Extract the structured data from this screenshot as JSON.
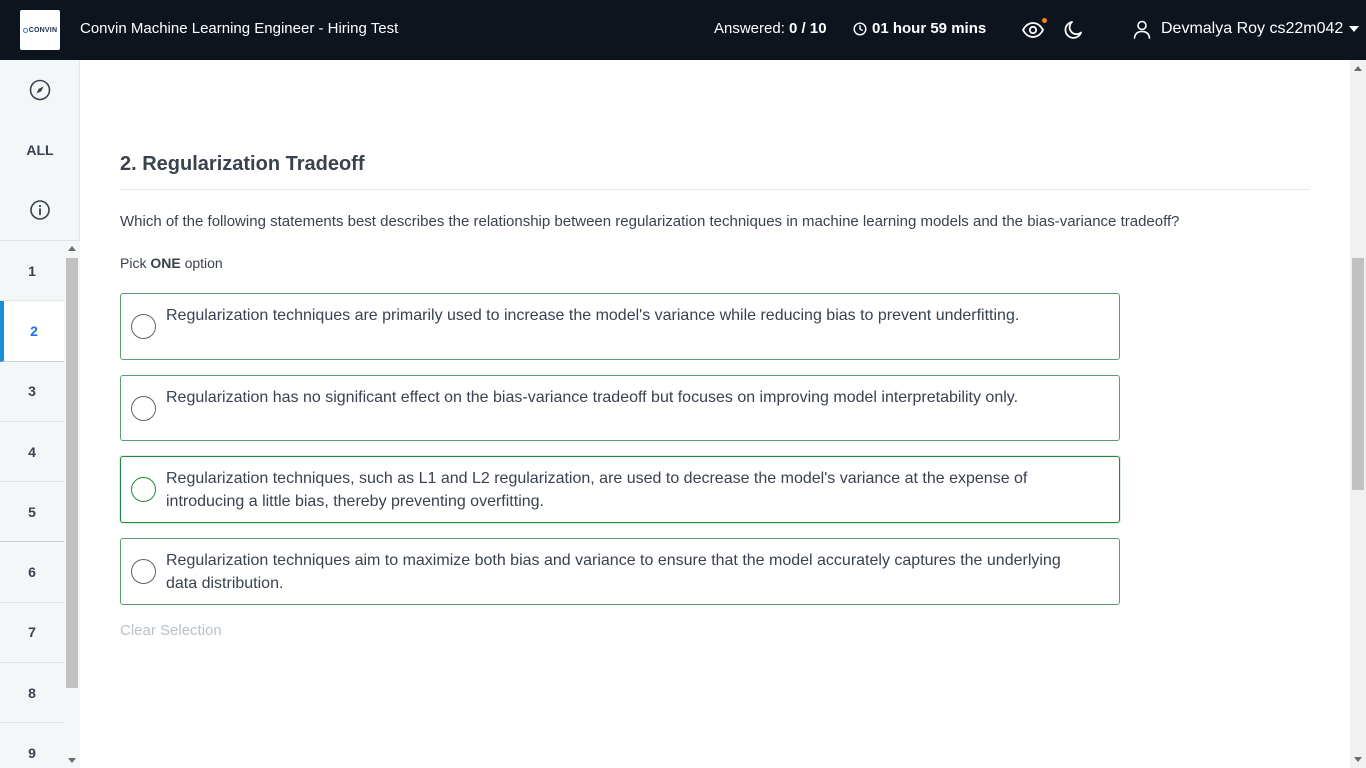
{
  "header": {
    "logo_text": "CONVIN",
    "test_title": "Convin Machine Learning Engineer - Hiring Test",
    "answered_label": "Answered:",
    "answered_value": "0 / 10",
    "timer": "01 hour 59 mins",
    "user_name": "Devmalya Roy cs22m042",
    "eye_dot_color": "#f5841f"
  },
  "sidebar": {
    "all_label": "ALL",
    "questions": [
      "1",
      "2",
      "3",
      "4",
      "5",
      "6",
      "7",
      "8",
      "9"
    ],
    "active_question": "2"
  },
  "question": {
    "title": "2. Regularization Tradeoff",
    "text": "Which of the following statements best describes the relationship between regularization techniques in machine learning models and the bias-variance tradeoff?",
    "pick_prefix": "Pick ",
    "pick_bold": "ONE",
    "pick_suffix": " option",
    "options": [
      "Regularization techniques are primarily used to increase the model's variance while reducing bias to prevent underfitting.",
      "Regularization has no significant effect on the bias-variance tradeoff but focuses on improving model interpretability only.",
      "Regularization techniques, such as L1 and L2 regularization, are used to decrease the model's variance at the expense of introducing a little bias, thereby preventing overfitting.",
      "Regularization techniques aim to maximize both bias and variance to ensure that the model accurately captures the underlying data distribution."
    ],
    "clear_label": "Clear Selection"
  }
}
